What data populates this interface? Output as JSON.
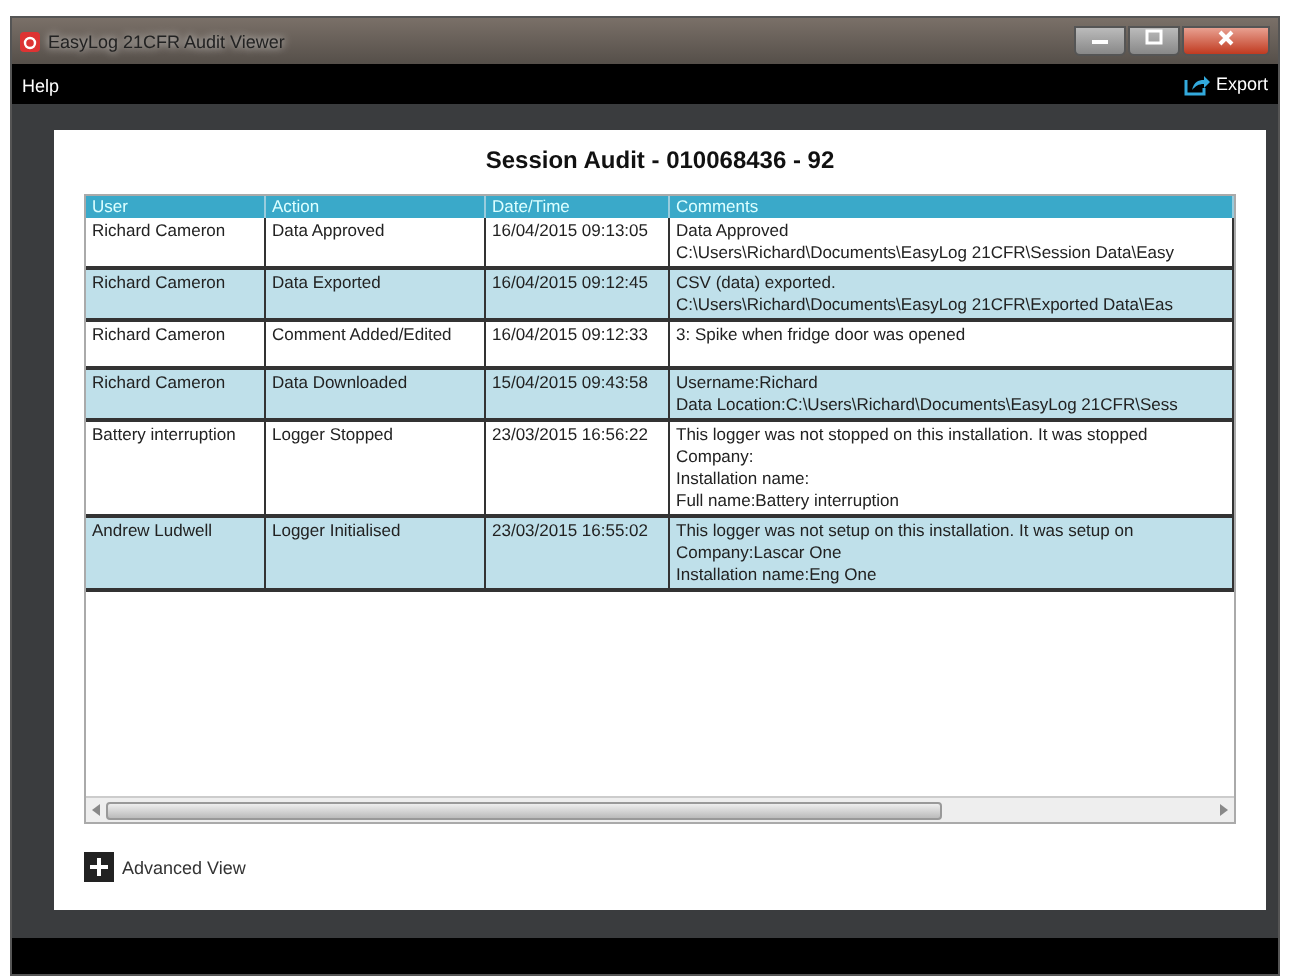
{
  "window": {
    "title": "EasyLog 21CFR Audit Viewer"
  },
  "menu": {
    "items": [
      "Help"
    ],
    "export": "Export"
  },
  "report": {
    "title": "Session Audit - 010068436 - 92"
  },
  "table": {
    "columns": [
      "User",
      "Action",
      "Date/Time",
      "Comments"
    ],
    "rows": [
      {
        "user": "Richard Cameron",
        "action": "Data Approved",
        "datetime": "16/04/2015 09:13:05",
        "comments": [
          "Data Approved",
          "C:\\Users\\Richard\\Documents\\EasyLog 21CFR\\Session Data\\Easy"
        ]
      },
      {
        "user": "Richard Cameron",
        "action": "Data Exported",
        "datetime": "16/04/2015 09:12:45",
        "comments": [
          "CSV (data) exported.",
          "C:\\Users\\Richard\\Documents\\EasyLog 21CFR\\Exported Data\\Eas"
        ]
      },
      {
        "user": "Richard Cameron",
        "action": "Comment Added/Edited",
        "datetime": "16/04/2015 09:12:33",
        "comments": [
          "3: Spike when fridge door was opened"
        ]
      },
      {
        "user": "Richard Cameron",
        "action": "Data Downloaded",
        "datetime": "15/04/2015 09:43:58",
        "comments": [
          "Username:Richard",
          "Data Location:C:\\Users\\Richard\\Documents\\EasyLog 21CFR\\Sess"
        ]
      },
      {
        "user": "Battery interruption",
        "action": "Logger Stopped",
        "datetime": "23/03/2015 16:56:22",
        "comments": [
          "This logger was not stopped on this installation. It was stopped",
          "Company:",
          "Installation name:",
          "Full name:Battery interruption"
        ]
      },
      {
        "user": "Andrew Ludwell",
        "action": "Logger Initialised",
        "datetime": "23/03/2015 16:55:02",
        "comments": [
          "This logger was not setup on this installation. It was setup on",
          "Company:Lascar One",
          "Installation name:Eng One"
        ]
      }
    ]
  },
  "advanced_view": {
    "label": "Advanced View",
    "expanded": false
  }
}
